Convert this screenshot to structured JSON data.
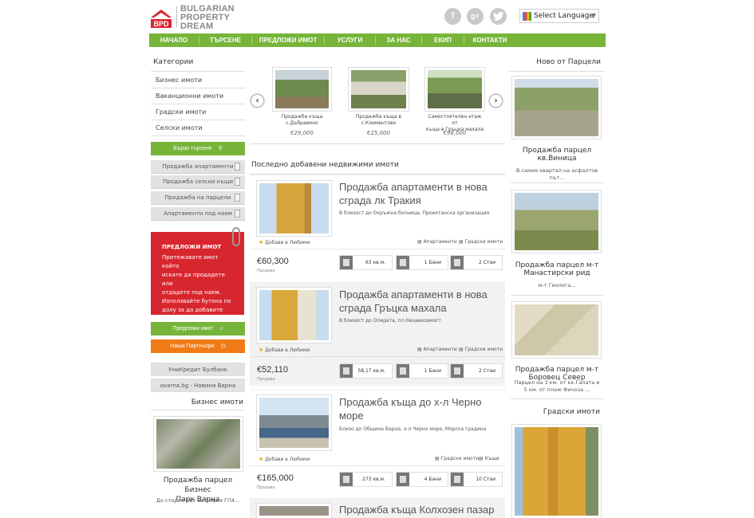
{
  "brand": {
    "line1": "BULGARIAN",
    "line2": "PROPERTY",
    "line3": "DREAM",
    "mark": "BPD"
  },
  "social": [
    "f",
    "g+",
    "twitter-icon"
  ],
  "language": {
    "label": "Select Language",
    "arrow": "▼"
  },
  "nav": [
    "НАЧАЛО",
    "ТЪРСЕНЕ",
    "ПРЕДЛОЖИ ИМОТ",
    "УСЛУГИ",
    "ЗА НАС",
    "ЕКИП",
    "КОНТАКТИ"
  ],
  "sidebar": {
    "title": "Категории",
    "categories": [
      "Бизнес имоти",
      "Ваканционни имоти",
      "Градски имоти",
      "Селски имоти"
    ],
    "quick_search": "Бързо търсене",
    "quick_links": [
      "Продажба апартаменти",
      "Продажба селски къщи",
      "Продажба на парцели",
      "Апартаменти под наем"
    ],
    "offer_box": {
      "title": "ПРЕДЛОЖИ ИМОТ",
      "line1": "Притежавате имот който",
      "line2": "искате да продадете или",
      "line3": "отдадете под наем.",
      "line4": "Използвайте бутона по",
      "line5": "долу за да добавите",
      "bold": "имот"
    },
    "offer_button": "Предложи имот",
    "partners_button": "Наши Партньори",
    "partners": [
      "УниКредит Булбанк",
      "ovarna.bg - Новини Варна"
    ],
    "business_title": "Бизнес имоти",
    "business_item": {
      "title1": "Продажба парцел Бизнес",
      "title2": "Парк Варна",
      "desc": "До стория път за София ГП4..."
    }
  },
  "carousel": {
    "items": [
      {
        "cap1": "Продажба къща",
        "cap2": "с.Дъбравино",
        "price": "€29,000"
      },
      {
        "cap1": "Продажба къща в",
        "cap2": "с.Климентово",
        "price": "€25,000"
      },
      {
        "cap1": "Самостоятелен етаж от",
        "cap2": "къща в Гръцка махала",
        "price": "€98,000"
      }
    ],
    "prev": "‹",
    "next": "›"
  },
  "latest": {
    "title": "Последно добавени недвижими имоти",
    "favorites": "Добави в Любими",
    "listings": [
      {
        "title1": "Продажба апартаменти в нова",
        "title2": "сграда лк Тракия",
        "desc": "В близост до Окръжна болница, Проектанска организация",
        "tags": [
          "Апартаменти",
          "Градски имоти"
        ],
        "price": "€60,300",
        "status": "Продава",
        "area": "63 кв.м.",
        "baths": "1 Бани",
        "rooms": "2 Стаи"
      },
      {
        "title1": "Продажба апартаменти в нова",
        "title2": "сграда Гръцка махала",
        "desc": "В близост до Операта, пл.Независимост",
        "tags": [
          "Апартаменти",
          "Градски имоти"
        ],
        "price": "€52,110",
        "status": "Продава",
        "area": "58,17 кв.м.",
        "baths": "1 Бани",
        "rooms": "2 Стаи"
      },
      {
        "title1": "Продажба къща до х-л Черно море",
        "title2": "",
        "desc": "Близо до Община Варна, х-л Черно море, Морска градина",
        "tags": [
          "Градски имоти",
          "Къщи"
        ],
        "price": "€165,000",
        "status": "Продава",
        "area": "273 кв.м.",
        "baths": "4 Бани",
        "rooms": "10 Стаи"
      },
      {
        "title1": "Продажба къща Колхозен пазар",
        "title2": "",
        "desc": "",
        "tags": [],
        "price": "",
        "status": "",
        "area": "",
        "baths": "",
        "rooms": ""
      }
    ]
  },
  "right": {
    "title": "Ново от Парцели",
    "items": [
      {
        "t1": "Продажба парцел",
        "t2": "кв.Виница",
        "d1": "В самия квартал на асфалтов път...",
        "d2": ""
      },
      {
        "t1": "Продажба парцел м-т",
        "t2": "Манастирски рид",
        "d1": "м-т Геолога...",
        "d2": ""
      },
      {
        "t1": "Продажба парцел м-т",
        "t2": "Боровец Север",
        "d1": "Парцел на 3 км. от кк.Галата и",
        "d2": "5 км. от плаж Фичоза ..."
      }
    ],
    "city_title": "Градски имоти"
  }
}
